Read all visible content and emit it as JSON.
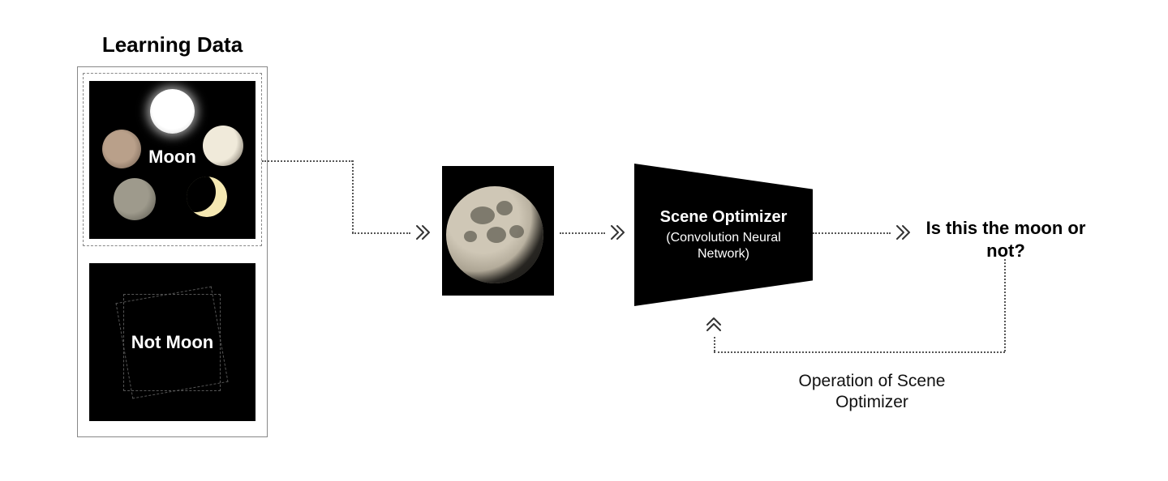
{
  "title": "Learning Data",
  "moon_tile_label": "Moon",
  "not_moon_tile_label": "Not Moon",
  "optimizer": {
    "title": "Scene Optimizer",
    "subtitle": "(Convolution Neural Network)"
  },
  "output_question": "Is this the moon or not?",
  "feedback_caption": "Operation of Scene Optimizer"
}
